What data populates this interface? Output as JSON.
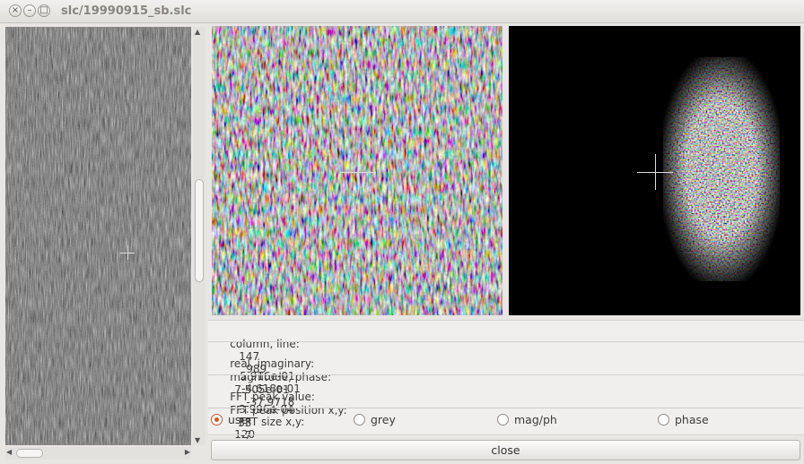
{
  "window": {
    "title": "slc/19990915_sb.slc",
    "close_symbol": "×",
    "min_symbol": "–",
    "max_symbol": "□"
  },
  "info": {
    "column_line_label": "column, line:",
    "column": "147",
    "line": "989",
    "real_imag_label": "real, imaginary:",
    "real": "5.916e-01",
    "imaginary": "-4.618e-01",
    "mag_phase_label": "magnitude, phase:",
    "magnitude": "7.505e-01",
    "phase": "-37.9718",
    "fft_peak_value_label": "FFT peak value:",
    "fft_peak_value": "3.996e-04",
    "fft_size_label": "FFT size x,y:",
    "fft_size_x": "120",
    "fft_size_y": "120",
    "fft_peak_pos_label": "FFT peak position x,y:",
    "fft_peak_x": "33",
    "fft_peak_y": "-7"
  },
  "display_modes": [
    {
      "label": "user",
      "selected": true
    },
    {
      "label": "grey",
      "selected": false
    },
    {
      "label": "mag/ph",
      "selected": false
    },
    {
      "label": "phase",
      "selected": false
    }
  ],
  "buttons": {
    "close": "close"
  },
  "icons": {
    "scroll_up": "▲",
    "scroll_down": "▼",
    "scroll_left": "◀",
    "scroll_right": "▶"
  },
  "colors": {
    "radio_selected": "#d15a22"
  }
}
